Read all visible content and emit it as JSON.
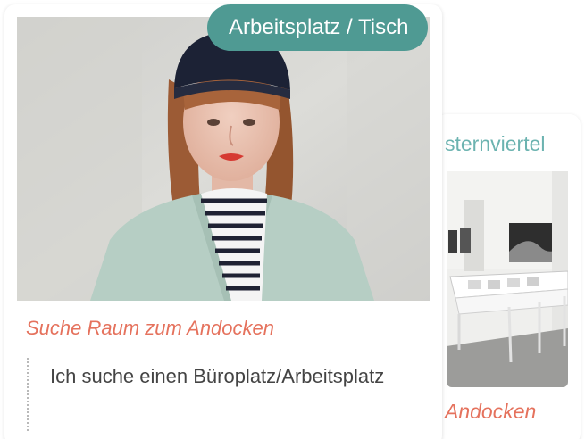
{
  "cards": {
    "front": {
      "badge_label": "Arbeitsplatz / Tisch",
      "subtitle": "Suche Raum zum Andocken",
      "description": "Ich suche einen Büroplatz/Arbeitsplatz"
    },
    "back": {
      "title_fragment": "sternviertel",
      "footer_fragment": "Andocken"
    }
  },
  "colors": {
    "accent_teal": "#4f9a93",
    "title_teal": "#6cb3b0",
    "coral": "#e5725d",
    "text_dark": "#444444"
  }
}
